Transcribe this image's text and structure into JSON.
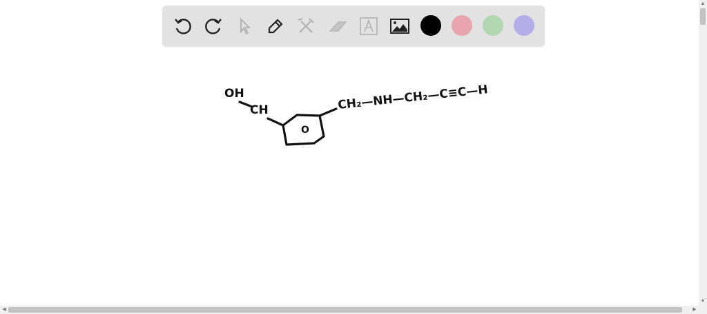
{
  "toolbar": {
    "tools": [
      "undo-icon",
      "redo-icon",
      "select-icon",
      "pen-icon",
      "tools-icon",
      "eraser-icon",
      "text-icon",
      "image-icon"
    ],
    "colors": [
      "#000000",
      "#e8a5ad",
      "#b3d6b3",
      "#b4aee8"
    ]
  },
  "drawing": {
    "oh": "OH",
    "ch": "CH",
    "ring": "O",
    "chain1": "CH₂—NH—CH₂—C≡C—H"
  }
}
